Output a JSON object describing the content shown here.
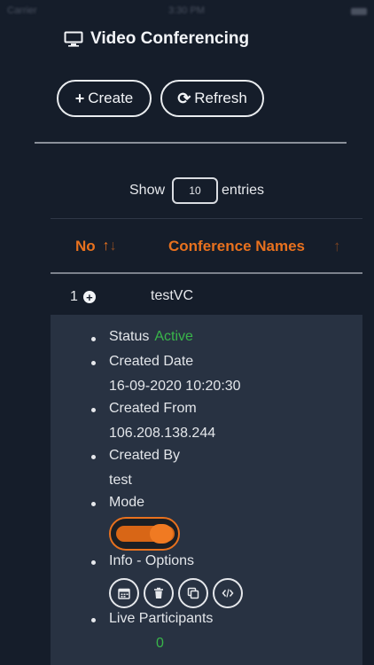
{
  "statusbar": {
    "carrier": "Carrier",
    "time": "3:30 PM"
  },
  "header": {
    "title": "Video Conferencing",
    "icon": "monitor-icon"
  },
  "actions": {
    "create_label": "Create",
    "refresh_label": "Refresh"
  },
  "entries": {
    "show_label": "Show",
    "value": "10",
    "suffix": "entries"
  },
  "table": {
    "columns": [
      {
        "label": "No",
        "sort_icon": "sort-both-icon"
      },
      {
        "label": "Conference Names",
        "sort_icon": "sort-up-icon"
      }
    ],
    "rows": [
      {
        "no": "1",
        "name": "testVC",
        "expanded": true
      }
    ]
  },
  "details": {
    "status_label": "Status",
    "status_value": "Active",
    "created_date_label": "Created Date",
    "created_date_value": "16-09-2020 10:20:30",
    "created_from_label": "Created From",
    "created_from_value": "106.208.138.244",
    "created_by_label": "Created By",
    "created_by_value": "test",
    "mode_label": "Mode",
    "mode_on": true,
    "info_label": "Info - Options",
    "info_icons": [
      "calendar-icon",
      "trash-icon",
      "copy-icon",
      "code-icon"
    ],
    "live_label": "Live Participants",
    "live_value": "0"
  },
  "colors": {
    "accent": "#e8711e",
    "status_green": "#39b54a",
    "background": "#151d2a",
    "panel": "#283242"
  }
}
